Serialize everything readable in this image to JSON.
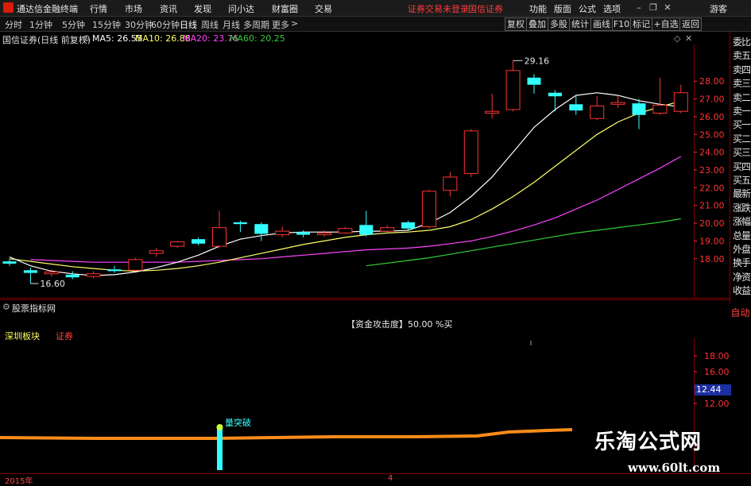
{
  "app": {
    "title": "通达信金融终端",
    "menu": [
      "行情",
      "市场",
      "资讯",
      "发现",
      "问小达",
      "财富圈",
      "交易"
    ],
    "notice": "证券交易未登录",
    "broker": "国信证券",
    "right_menu": [
      "功能",
      "版面",
      "公式",
      "选项"
    ],
    "guest": "游客"
  },
  "toolbar": {
    "periods": [
      "分时",
      "1分钟",
      "5分钟",
      "15分钟",
      "30分钟",
      "60分钟",
      "日线",
      "周线",
      "月线",
      "多周期",
      "更多"
    ],
    "active_period": "日线",
    "right_buttons": [
      "复权",
      "叠加",
      "多股",
      "统计",
      "画线",
      "F10",
      "标记",
      "+自选",
      "返回"
    ]
  },
  "chart_info": {
    "stock_name": "国信证券(日线 前复权)",
    "ma5_label": "MA5: 26.55",
    "ma10_label": "MA10: 26.88",
    "ma20_label": "MA20: 23.76",
    "ma60_label": "MA60: 20.25",
    "colors": {
      "ma5": "#ffffff",
      "ma10": "#ffff66",
      "ma20": "#ff44ff",
      "ma60": "#33cc33",
      "up": "#ff3333",
      "down": "#33ffff",
      "axis": "#ff3333"
    }
  },
  "side_panel": [
    "委比",
    "卖五",
    "卖四",
    "卖三",
    "卖二",
    "卖一",
    "买一",
    "买二",
    "买三",
    "买四",
    "买五",
    "最新",
    "涨跌",
    "涨幅",
    "总量",
    "外盘",
    "换手",
    "净资",
    "收益"
  ],
  "side_auto": "自动",
  "indicator": {
    "name": "股票指标网",
    "summary": "【资金攻击度】50.00 %买",
    "labels": [
      "深圳板块",
      "证券"
    ],
    "signal_label": "量突破",
    "current_value": "12.44"
  },
  "date_label": "2015年",
  "date_tick": "4",
  "watermark": {
    "line1": "乐淘公式网",
    "line2": "www.60lt.com"
  },
  "chart_data": {
    "type": "candlestick",
    "price_axis": {
      "ticks": [
        18.0,
        19.0,
        20.0,
        21.0,
        22.0,
        23.0,
        24.0,
        25.0,
        26.0,
        27.0,
        28.0
      ],
      "range": [
        16.2,
        29.8
      ]
    },
    "annotations": {
      "high": "29.16",
      "low": "16.60"
    },
    "indicator_axis": {
      "ticks": [
        12.0,
        14.0,
        16.0,
        18.0
      ]
    },
    "candles": [
      {
        "o": 17.85,
        "c": 17.72,
        "h": 18.0,
        "l": 17.6
      },
      {
        "o": 17.35,
        "c": 17.2,
        "h": 17.5,
        "l": 16.6
      },
      {
        "o": 17.15,
        "c": 17.25,
        "h": 17.4,
        "l": 17.0
      },
      {
        "o": 17.1,
        "c": 16.95,
        "h": 17.3,
        "l": 16.85
      },
      {
        "o": 17.0,
        "c": 17.15,
        "h": 17.3,
        "l": 16.9
      },
      {
        "o": 17.4,
        "c": 17.3,
        "h": 17.6,
        "l": 17.2
      },
      {
        "o": 17.35,
        "c": 17.95,
        "h": 18.05,
        "l": 17.3
      },
      {
        "o": 18.3,
        "c": 18.45,
        "h": 18.6,
        "l": 18.1
      },
      {
        "o": 18.7,
        "c": 18.95,
        "h": 19.0,
        "l": 18.6
      },
      {
        "o": 19.1,
        "c": 18.85,
        "h": 19.2,
        "l": 18.75
      },
      {
        "o": 18.7,
        "c": 19.75,
        "h": 20.7,
        "l": 18.6
      },
      {
        "o": 20.05,
        "c": 19.95,
        "h": 20.15,
        "l": 19.5
      },
      {
        "o": 19.95,
        "c": 19.4,
        "h": 20.05,
        "l": 19.0
      },
      {
        "o": 19.35,
        "c": 19.55,
        "h": 19.8,
        "l": 19.2
      },
      {
        "o": 19.5,
        "c": 19.35,
        "h": 19.6,
        "l": 19.2
      },
      {
        "o": 19.35,
        "c": 19.45,
        "h": 19.6,
        "l": 19.25
      },
      {
        "o": 19.45,
        "c": 19.7,
        "h": 19.8,
        "l": 19.4
      },
      {
        "o": 19.9,
        "c": 19.35,
        "h": 20.7,
        "l": 19.25
      },
      {
        "o": 19.55,
        "c": 19.75,
        "h": 19.9,
        "l": 19.45
      },
      {
        "o": 20.05,
        "c": 19.7,
        "h": 20.15,
        "l": 19.6
      },
      {
        "o": 19.8,
        "c": 21.8,
        "h": 21.9,
        "l": 19.7
      },
      {
        "o": 21.85,
        "c": 22.6,
        "h": 22.9,
        "l": 21.5
      },
      {
        "o": 22.8,
        "c": 25.2,
        "h": 25.3,
        "l": 22.6
      },
      {
        "o": 26.2,
        "c": 26.3,
        "h": 27.3,
        "l": 25.9
      },
      {
        "o": 26.4,
        "c": 28.6,
        "h": 29.16,
        "l": 26.3
      },
      {
        "o": 28.2,
        "c": 27.8,
        "h": 28.4,
        "l": 27.3
      },
      {
        "o": 27.35,
        "c": 27.15,
        "h": 27.5,
        "l": 26.3
      },
      {
        "o": 26.7,
        "c": 26.35,
        "h": 27.2,
        "l": 26.1
      },
      {
        "o": 25.9,
        "c": 26.6,
        "h": 27.15,
        "l": 25.8
      },
      {
        "o": 26.7,
        "c": 26.8,
        "h": 27.2,
        "l": 26.5
      },
      {
        "o": 26.75,
        "c": 26.1,
        "h": 27.0,
        "l": 25.3
      },
      {
        "o": 26.2,
        "c": 26.65,
        "h": 28.2,
        "l": 26.1
      },
      {
        "o": 26.3,
        "c": 27.35,
        "h": 27.8,
        "l": 26.2
      }
    ],
    "ma": {
      "ma5": [
        18.1,
        17.6,
        17.3,
        17.15,
        17.05,
        17.1,
        17.25,
        17.5,
        17.8,
        18.2,
        18.7,
        19.1,
        19.3,
        19.45,
        19.5,
        19.5,
        19.5,
        19.55,
        19.55,
        19.6,
        20.0,
        20.6,
        21.5,
        22.6,
        24.0,
        25.4,
        26.4,
        27.2,
        27.35,
        27.2,
        26.9,
        26.7,
        26.55
      ],
      "ma10": [
        18.0,
        17.85,
        17.7,
        17.55,
        17.45,
        17.35,
        17.3,
        17.35,
        17.45,
        17.6,
        17.8,
        18.05,
        18.3,
        18.55,
        18.8,
        19.0,
        19.2,
        19.35,
        19.45,
        19.5,
        19.6,
        19.8,
        20.2,
        20.8,
        21.5,
        22.3,
        23.2,
        24.1,
        25.0,
        25.7,
        26.2,
        26.55,
        26.88
      ],
      "ma20": [
        null,
        17.95,
        17.9,
        17.85,
        17.8,
        17.8,
        17.8,
        17.8,
        17.8,
        17.85,
        17.9,
        17.95,
        18.0,
        18.1,
        18.2,
        18.3,
        18.4,
        18.5,
        18.55,
        18.6,
        18.7,
        18.85,
        19.0,
        19.25,
        19.55,
        19.9,
        20.3,
        20.8,
        21.3,
        21.9,
        22.5,
        23.1,
        23.76
      ],
      "ma60": [
        null,
        null,
        null,
        null,
        null,
        null,
        null,
        null,
        null,
        null,
        null,
        null,
        null,
        null,
        null,
        null,
        null,
        17.6,
        17.75,
        17.9,
        18.05,
        18.25,
        18.45,
        18.65,
        18.85,
        19.05,
        19.25,
        19.45,
        19.6,
        19.75,
        19.9,
        20.05,
        20.25
      ]
    }
  }
}
